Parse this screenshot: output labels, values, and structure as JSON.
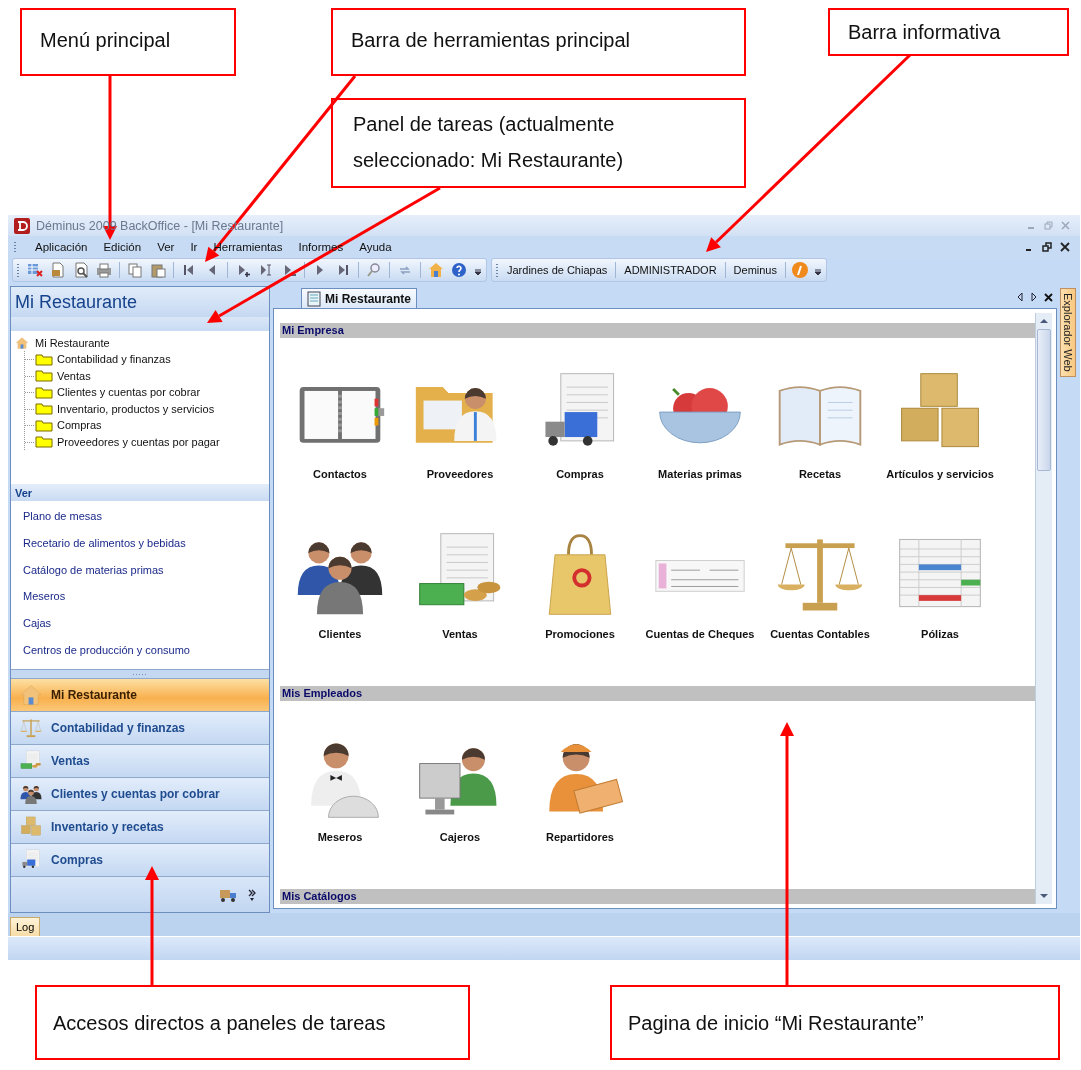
{
  "callouts": [
    {
      "text": "Menú principal"
    },
    {
      "text": "Barra de herramientas principal"
    },
    {
      "text": "Barra informativa"
    },
    {
      "text": "Panel de tareas (actualmente seleccionado: Mi Restaurante)"
    },
    {
      "text": "Accesos directos a paneles de tareas"
    },
    {
      "text": "Pagina de inicio “Mi Restaurante”"
    }
  ],
  "window": {
    "title": "Déminus 2009 BackOffice - [Mi Restaurante]"
  },
  "menu": [
    "Aplicación",
    "Edición",
    "Ver",
    "Ir",
    "Herramientas",
    "Informes",
    "Ayuda"
  ],
  "info_bar": [
    "Jardines de Chiapas",
    "ADMINISTRADOR",
    "Deminus"
  ],
  "task_panel": {
    "title": "Mi Restaurante",
    "tree": {
      "label": "Mi Restaurante",
      "children": [
        {
          "label": "Contabilidad y finanzas"
        },
        {
          "label": "Ventas"
        },
        {
          "label": "Clientes y cuentas por cobrar"
        },
        {
          "label": "Inventario, productos y servicios"
        },
        {
          "label": "Compras"
        },
        {
          "label": "Proveedores y cuentas por pagar"
        }
      ]
    },
    "view_header": "Ver",
    "view_links": [
      "Plano de mesas",
      "Recetario de alimentos y bebidas",
      "Catálogo de materias primas",
      "Meseros",
      "Cajas",
      "Centros de producción y consumo"
    ]
  },
  "shortcuts": [
    {
      "label": "Mi Restaurante",
      "selected": true
    },
    {
      "label": "Contabilidad y finanzas",
      "selected": false
    },
    {
      "label": "Ventas",
      "selected": false
    },
    {
      "label": "Clientes y cuentas por cobrar",
      "selected": false
    },
    {
      "label": "Inventario y recetas",
      "selected": false
    },
    {
      "label": "Compras",
      "selected": false
    }
  ],
  "bottom_tab": "Log",
  "document_tab": "Mi Restaurante",
  "side_tab": "Explorador Web",
  "sections": [
    {
      "title": "Mi Empresa",
      "items": [
        {
          "label": "Contactos"
        },
        {
          "label": "Proveedores"
        },
        {
          "label": "Compras"
        },
        {
          "label": "Materias primas"
        },
        {
          "label": "Recetas"
        },
        {
          "label": "Artículos y servicios"
        },
        {
          "label": "Clientes"
        },
        {
          "label": "Ventas"
        },
        {
          "label": "Promociones"
        },
        {
          "label": "Cuentas de Cheques"
        },
        {
          "label": "Cuentas Contables"
        },
        {
          "label": "Pólizas"
        }
      ]
    },
    {
      "title": "Mis Empleados",
      "items": [
        {
          "label": "Meseros"
        },
        {
          "label": "Cajeros"
        },
        {
          "label": "Repartidores"
        }
      ]
    },
    {
      "title": "Mis Catálogos"
    }
  ]
}
